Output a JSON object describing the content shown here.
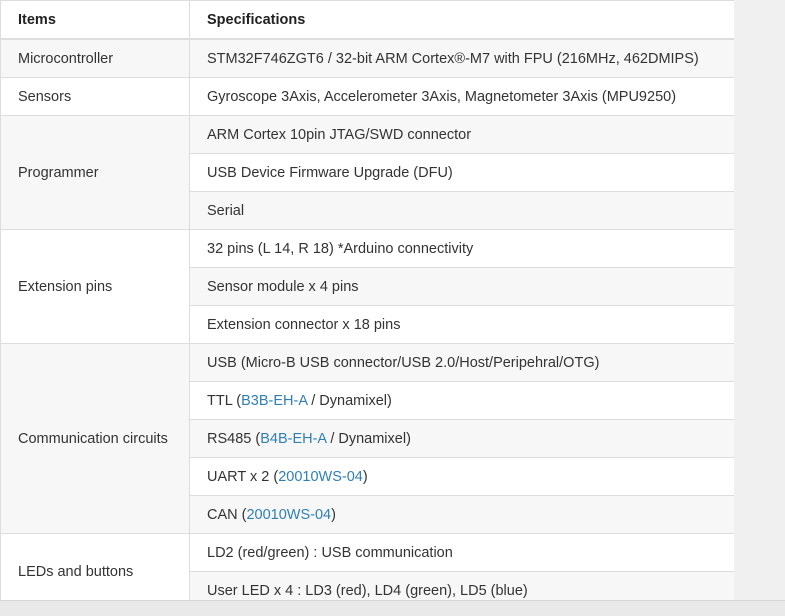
{
  "table": {
    "headers": {
      "items": "Items",
      "specifications": "Specifications"
    },
    "microcontroller": {
      "item": "Microcontroller",
      "spec": "STM32F746ZGT6 / 32-bit ARM Cortex®-M7 with FPU (216MHz, 462DMIPS)"
    },
    "sensors": {
      "item": "Sensors",
      "spec": "Gyroscope 3Axis, Accelerometer 3Axis, Magnetometer 3Axis (MPU9250)"
    },
    "programmer": {
      "item": "Programmer",
      "specs": [
        "ARM Cortex 10pin JTAG/SWD connector",
        "USB Device Firmware Upgrade (DFU)",
        "Serial"
      ]
    },
    "extension_pins": {
      "item": "Extension pins",
      "specs": [
        "32 pins (L 14, R 18) *Arduino connectivity",
        "Sensor module x 4 pins",
        "Extension connector x 18 pins"
      ]
    },
    "communication": {
      "item": "Communication circuits",
      "usb": "USB (Micro-B USB connector/USB 2.0/Host/Peripehral/OTG)",
      "ttl": {
        "prefix": "TTL (",
        "link": "B3B-EH-A",
        "suffix": " / Dynamixel)"
      },
      "rs485": {
        "prefix": "RS485 (",
        "link": "B4B-EH-A",
        "suffix": " / Dynamixel)"
      },
      "uart": {
        "prefix": "UART x 2 (",
        "link": "20010WS-04",
        "suffix": ")"
      },
      "can": {
        "prefix": "CAN (",
        "link": "20010WS-04",
        "suffix": ")"
      }
    },
    "leds_buttons": {
      "item": "LEDs and buttons",
      "specs": [
        "LD2 (red/green) : USB communication",
        "User LED x 4 : LD3 (red), LD4 (green), LD5 (blue)"
      ]
    }
  },
  "colors": {
    "link": "#2f7fb5",
    "border": "#dddddd",
    "stripe": "#f7f7f7",
    "text": "#333333"
  }
}
